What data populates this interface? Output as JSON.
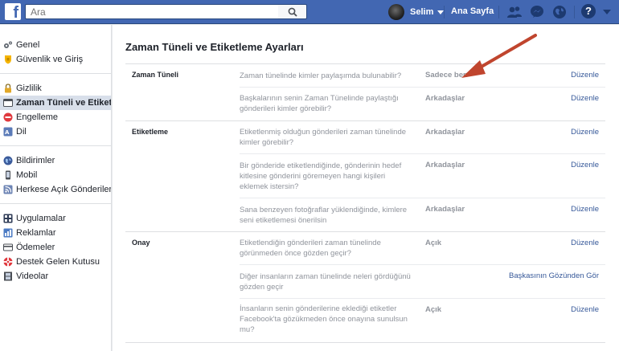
{
  "topbar": {
    "logo": "f",
    "search_placeholder": "Ara",
    "user_name": "Selim",
    "home_label": "Ana Sayfa",
    "help_label": "?"
  },
  "sidebar": {
    "groups": [
      [
        {
          "label": "Genel",
          "icon": "gear-icon"
        },
        {
          "label": "Güvenlik ve Giriş",
          "icon": "shield-icon"
        }
      ],
      [
        {
          "label": "Gizlilik",
          "icon": "lock-icon"
        },
        {
          "label": "Zaman Tüneli ve Etiket...",
          "icon": "timeline-icon",
          "active": true
        },
        {
          "label": "Engelleme",
          "icon": "block-icon"
        },
        {
          "label": "Dil",
          "icon": "language-icon"
        }
      ],
      [
        {
          "label": "Bildirimler",
          "icon": "globe-icon"
        },
        {
          "label": "Mobil",
          "icon": "mobile-icon"
        },
        {
          "label": "Herkese Açık Gönderiler",
          "icon": "rss-icon"
        }
      ],
      [
        {
          "label": "Uygulamalar",
          "icon": "apps-icon"
        },
        {
          "label": "Reklamlar",
          "icon": "ads-icon"
        },
        {
          "label": "Ödemeler",
          "icon": "card-icon"
        },
        {
          "label": "Destek Gelen Kutusu",
          "icon": "lifebuoy-icon"
        },
        {
          "label": "Videolar",
          "icon": "film-icon"
        }
      ]
    ]
  },
  "main": {
    "title": "Zaman Tüneli ve Etiketleme Ayarları",
    "sections": [
      {
        "label": "Zaman Tüneli",
        "rows": [
          {
            "question": "Zaman tünelinde kimler paylaşımda bulunabilir?",
            "value": "Sadece ben",
            "edit": "Düzenle"
          },
          {
            "question": "Başkalarının senin Zaman Tünelinde paylaştığı gönderileri kimler görebilir?",
            "value": "Arkadaşlar",
            "edit": "Düzenle"
          }
        ]
      },
      {
        "label": "Etiketleme",
        "rows": [
          {
            "question": "Etiketlenmiş olduğun gönderileri zaman tünelinde kimler görebilir?",
            "value": "Arkadaşlar",
            "edit": "Düzenle"
          },
          {
            "question": "Bir gönderide etiketlendiğinde, gönderinin hedef kitlesine gönderini göremeyen hangi kişileri eklemek istersin?",
            "value": "Arkadaşlar",
            "edit": "Düzenle"
          },
          {
            "question": "Sana benzeyen fotoğraflar yüklendiğinde, kimlere seni etiketlemesi önerilsin",
            "value": "Arkadaşlar",
            "edit": "Düzenle"
          }
        ]
      },
      {
        "label": "Onay",
        "rows": [
          {
            "question": "Etiketlendiğin gönderileri zaman tünelinde görünmeden önce gözden geçir?",
            "value": "Açık",
            "edit": "Düzenle"
          },
          {
            "question": "Diğer insanların zaman tünelinde neleri gördüğünü gözden geçir",
            "value": "",
            "edit": "Başkasının Gözünden Gör"
          },
          {
            "question": "İnsanların senin gönderilerine eklediği etiketler Facebook'ta gözükmeden önce onayına sunulsun mu?",
            "value": "Açık",
            "edit": "Düzenle"
          }
        ]
      }
    ]
  },
  "colors": {
    "topbar": "#4267b2",
    "link": "#365899",
    "muted": "#90949c",
    "annotation_arrow": "#c0452e"
  }
}
